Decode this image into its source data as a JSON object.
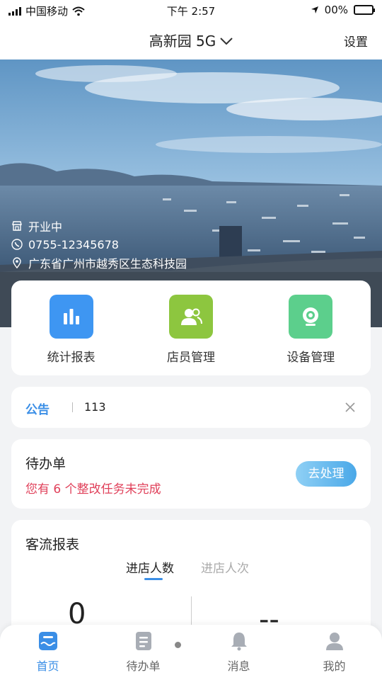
{
  "status": {
    "carrier": "中国移动",
    "time": "下午 2:57",
    "battery": "00%"
  },
  "header": {
    "title": "高新园 5G",
    "settings": "设置"
  },
  "store": {
    "status": "开业中",
    "phone": "0755-12345678",
    "address": "广东省广州市越秀区生态科技园"
  },
  "quick": [
    {
      "label": "统计报表",
      "icon": "bar-chart-icon",
      "color": "#3e96f2"
    },
    {
      "label": "店员管理",
      "icon": "users-icon",
      "color": "#8dc63f"
    },
    {
      "label": "设备管理",
      "icon": "camera-icon",
      "color": "#5ccf8c"
    }
  ],
  "notice": {
    "tag": "公告",
    "text": "113"
  },
  "todo": {
    "title": "待办单",
    "subtitle": "您有 6 个整改任务未完成",
    "button": "去处理"
  },
  "traffic": {
    "title": "客流报表",
    "tabs": [
      "进店人数",
      "进店人次"
    ],
    "value_left": "0",
    "value_right": "--"
  },
  "tabbar": [
    {
      "label": "首页",
      "active": true
    },
    {
      "label": "待办单"
    },
    {
      "label": "消息"
    },
    {
      "label": "我的"
    }
  ],
  "colors": {
    "accent": "#3a8ee6",
    "alert": "#e0405a"
  }
}
